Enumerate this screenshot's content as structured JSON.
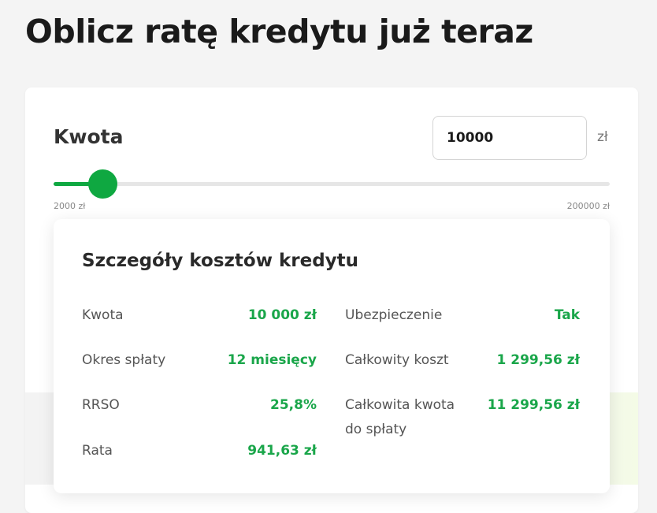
{
  "page": {
    "title": "Oblicz ratę kredytu już teraz"
  },
  "calculator": {
    "amount_label": "Kwota",
    "amount_value": "10000",
    "currency": "zł",
    "slider": {
      "min_label": "2000 zł",
      "max_label": "200000 zł",
      "min": 2000,
      "max": 200000,
      "value": 10000
    }
  },
  "details": {
    "title": "Szczegóły kosztów kredytu",
    "left": [
      {
        "label": "Kwota",
        "value": "10 000 zł"
      },
      {
        "label": "Okres spłaty",
        "value": "12 miesięcy"
      },
      {
        "label": "RRSO",
        "value": "25,8%"
      },
      {
        "label": "Rata",
        "value": "941,63 zł"
      }
    ],
    "right": [
      {
        "label": "Ubezpieczenie",
        "value": "Tak"
      },
      {
        "label": "Całkowity koszt",
        "value": "1 299,56 zł"
      },
      {
        "label": "Całkowita kwota\ndo spłaty",
        "value": "11 299,56 zł"
      }
    ]
  },
  "colors": {
    "accent": "#0fa841",
    "value_text": "#1aa64a"
  }
}
